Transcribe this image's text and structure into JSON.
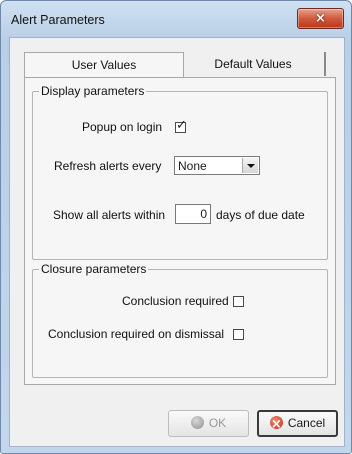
{
  "window": {
    "title": "Alert Parameters",
    "close_glyph": "×"
  },
  "tabs": [
    {
      "label": "User Values",
      "active": true
    },
    {
      "label": "Default Values",
      "active": false
    }
  ],
  "display_group": {
    "legend": "Display parameters",
    "popup_label": "Popup on login",
    "popup_checked": true,
    "popup_tick": "✓",
    "refresh_label": "Refresh alerts every",
    "refresh_value": "None",
    "show_label_before": "Show all alerts within",
    "days_value": "0",
    "show_label_after": "days of due date"
  },
  "closure_group": {
    "legend": "Closure parameters",
    "conclusion_label": "Conclusion required",
    "conclusion_checked": false,
    "dismissal_label": "Conclusion required on dismissal",
    "dismissal_checked": false
  },
  "buttons": {
    "ok_label": "OK",
    "ok_enabled": false,
    "cancel_label": "Cancel"
  },
  "icons": {
    "ok": "ok-icon",
    "cancel": "cancel-icon",
    "close": "close-icon",
    "dropdown": "chevron-down-icon"
  }
}
